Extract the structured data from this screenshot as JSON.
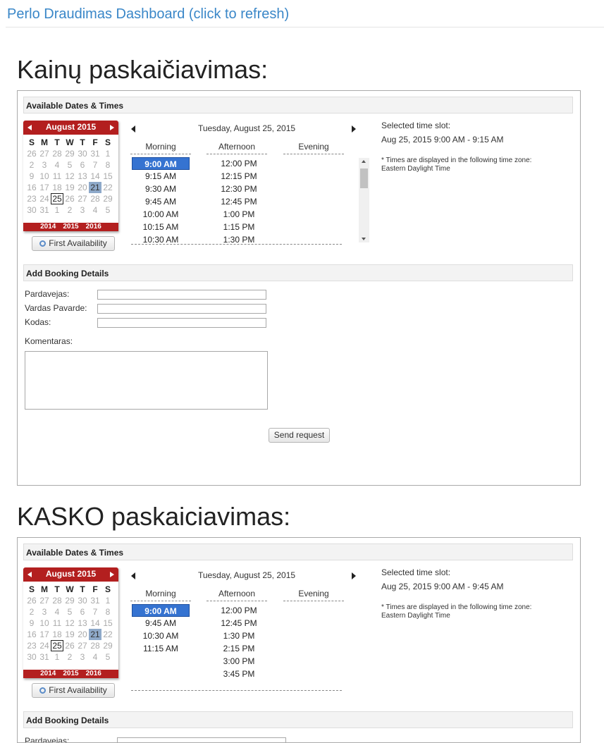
{
  "header": {
    "title": "Perlo Draudimas Dashboard (click to refresh)"
  },
  "forms": [
    {
      "title": "Kainų paskaičiavimas:",
      "available_label": "Available Dates & Times",
      "calendar": {
        "month_title": "August 2015",
        "weekdays": [
          "S",
          "M",
          "T",
          "W",
          "T",
          "F",
          "S"
        ],
        "rows": [
          [
            "26",
            "27",
            "28",
            "29",
            "30",
            "31",
            "1"
          ],
          [
            "2",
            "3",
            "4",
            "5",
            "6",
            "7",
            "8"
          ],
          [
            "9",
            "10",
            "11",
            "12",
            "13",
            "14",
            "15"
          ],
          [
            "16",
            "17",
            "18",
            "19",
            "20",
            "21",
            "22"
          ],
          [
            "23",
            "24",
            "25",
            "26",
            "27",
            "28",
            "29"
          ],
          [
            "30",
            "31",
            "1",
            "2",
            "3",
            "4",
            "5"
          ]
        ],
        "today": "25",
        "selected": "21",
        "years": [
          "2014",
          "2015",
          "2016"
        ]
      },
      "first_availability_label": "First Availability",
      "day_title": "Tuesday, August 25, 2015",
      "columns": {
        "morning": "Morning",
        "afternoon": "Afternoon",
        "evening": "Evening"
      },
      "morning_slots": [
        "9:00 AM",
        "9:15 AM",
        "9:30 AM",
        "9:45 AM",
        "10:00 AM",
        "10:15 AM",
        "10:30 AM"
      ],
      "afternoon_slots": [
        "12:00 PM",
        "12:15 PM",
        "12:30 PM",
        "12:45 PM",
        "1:00 PM",
        "1:15 PM",
        "1:30 PM"
      ],
      "evening_slots": [],
      "selected_slot_label": "Selected time slot:",
      "selected_slot_value": "Aug 25, 2015 9:00 AM - 9:15 AM",
      "timezone_note_1": "* Times are displayed in the following time zone:",
      "timezone_note_2": "Eastern Daylight Time",
      "booking_label": "Add Booking Details",
      "fields": {
        "seller": "Pardavejas:",
        "name": "Vardas Pavarde:",
        "code": "Kodas:",
        "comments": "Komentaras:"
      },
      "send_label": "Send request",
      "accent_color": "#b31f1f",
      "selected_slot_color": "#3573d1"
    },
    {
      "title": "KASKO paskaiciavimas:",
      "available_label": "Available Dates & Times",
      "calendar": {
        "month_title": "August 2015",
        "weekdays": [
          "S",
          "M",
          "T",
          "W",
          "T",
          "F",
          "S"
        ],
        "rows": [
          [
            "26",
            "27",
            "28",
            "29",
            "30",
            "31",
            "1"
          ],
          [
            "2",
            "3",
            "4",
            "5",
            "6",
            "7",
            "8"
          ],
          [
            "9",
            "10",
            "11",
            "12",
            "13",
            "14",
            "15"
          ],
          [
            "16",
            "17",
            "18",
            "19",
            "20",
            "21",
            "22"
          ],
          [
            "23",
            "24",
            "25",
            "26",
            "27",
            "28",
            "29"
          ],
          [
            "30",
            "31",
            "1",
            "2",
            "3",
            "4",
            "5"
          ]
        ],
        "today": "25",
        "selected": "21",
        "years": [
          "2014",
          "2015",
          "2016"
        ]
      },
      "first_availability_label": "First Availability",
      "day_title": "Tuesday, August 25, 2015",
      "columns": {
        "morning": "Morning",
        "afternoon": "Afternoon",
        "evening": "Evening"
      },
      "morning_slots": [
        "9:00 AM",
        "9:45 AM",
        "10:30 AM",
        "11:15 AM"
      ],
      "afternoon_slots": [
        "12:00 PM",
        "12:45 PM",
        "1:30 PM",
        "2:15 PM",
        "3:00 PM",
        "3:45 PM"
      ],
      "evening_slots": [],
      "selected_slot_label": "Selected time slot:",
      "selected_slot_value": "Aug 25, 2015 9:00 AM - 9:45 AM",
      "timezone_note_1": "* Times are displayed in the following time zone:",
      "timezone_note_2": "Eastern Daylight Time",
      "booking_label": "Add Booking Details",
      "fields": {
        "seller": "Pardavejas:"
      },
      "accent_color": "#b31f1f",
      "selected_slot_color": "#3573d1"
    }
  ]
}
